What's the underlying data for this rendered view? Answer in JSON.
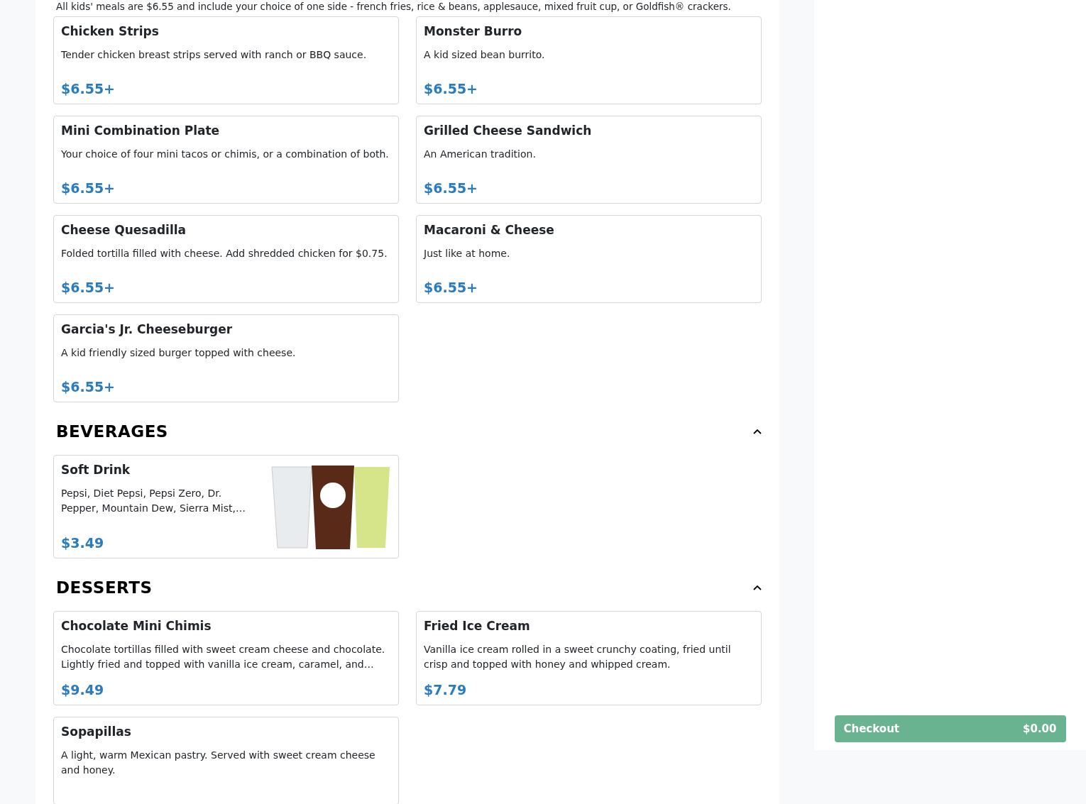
{
  "intro": "All kids' meals are $6.55 and include your choice of one side - french fries, rice & beans, applesauce, mixed fruit cup, or Goldfish® crackers.",
  "kids_items": [
    {
      "name": "Chicken Strips",
      "description": "Tender chicken breast strips served with ranch or BBQ sauce.",
      "price": "$6.55+"
    },
    {
      "name": "Monster Burro",
      "description": "A kid sized bean burrito.",
      "price": "$6.55+"
    },
    {
      "name": "Mini Combination Plate",
      "description": "Your choice of four mini tacos or chimis, or a combination of both.",
      "price": "$6.55+"
    },
    {
      "name": "Grilled Cheese Sandwich",
      "description": "An American tradition.",
      "price": "$6.55+"
    },
    {
      "name": "Cheese Quesadilla",
      "description": "Folded tortilla filled with cheese. Add shredded chicken for $0.75.",
      "price": "$6.55+"
    },
    {
      "name": "Macaroni & Cheese",
      "description": "Just like at home.",
      "price": "$6.55+"
    },
    {
      "name": "Garcia's Jr. Cheeseburger",
      "description": "A kid friendly sized burger topped with cheese.",
      "price": "$6.55+"
    }
  ],
  "sections": [
    {
      "title": "BEVERAGES",
      "expanded": true,
      "items": [
        {
          "name": "Soft Drink",
          "description": "Pepsi, Diet Pepsi, Pepsi Zero, Dr. Pepper, Mountain Dew, Sierra Mist,…",
          "price": "$3.49",
          "has_photo": true
        }
      ]
    },
    {
      "title": "DESSERTS",
      "expanded": true,
      "items": [
        {
          "name": "Chocolate Mini Chimis",
          "description": "Chocolate tortillas filled with sweet cream cheese and chocolate. Lightly fried and topped with vanilla ice cream, caramel, and…",
          "price": "$9.49",
          "has_photo": false
        },
        {
          "name": "Fried Ice Cream",
          "description": "Vanilla ice cream rolled in a sweet crunchy coating, fried until crisp and topped with honey and whipped cream.",
          "price": "$7.79",
          "has_photo": false
        },
        {
          "name": "Sopapillas",
          "description": "A light, warm Mexican pastry. Served with sweet cream cheese and honey.",
          "has_photo": false
        }
      ]
    }
  ],
  "checkout": {
    "label": "Checkout",
    "total": "$0.00"
  }
}
